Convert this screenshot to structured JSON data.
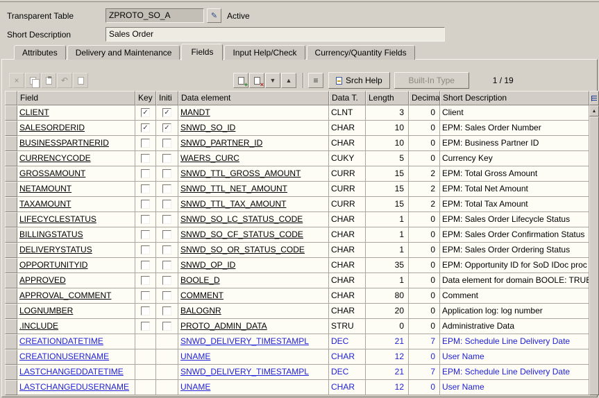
{
  "header": {
    "object_type_label": "Transparent Table",
    "object_name": "ZPROTO_SO_A",
    "status_label": "Active",
    "short_description_label": "Short Description",
    "short_description_value": "Sales Order"
  },
  "tabs": [
    {
      "label": "Attributes",
      "active": false
    },
    {
      "label": "Delivery and Maintenance",
      "active": false
    },
    {
      "label": "Fields",
      "active": true
    },
    {
      "label": "Input Help/Check",
      "active": false
    },
    {
      "label": "Currency/Quantity Fields",
      "active": false
    }
  ],
  "toolbar": {
    "srch_help_label": "Srch Help",
    "built_in_type_label": "Built-In Type",
    "position_indicator": "1  /  19"
  },
  "icons": {
    "check": "✓",
    "cut": "×",
    "undo": "↶",
    "plus": "+",
    "cross": "×",
    "filter": "▼",
    "expand": "▲",
    "display_change": "✎",
    "hierarchy": "≡",
    "scroll_up": "▲"
  },
  "table": {
    "columns": [
      "Field",
      "Key",
      "Initi",
      "Data element",
      "Data T.",
      "Length",
      "Decima",
      "Short Description"
    ],
    "rows": [
      {
        "field": "CLIENT",
        "key": true,
        "initial": true,
        "checkboxes": true,
        "data_element": "MANDT",
        "data_type": "CLNT",
        "length": "3",
        "decimals": "0",
        "description": "Client",
        "inherited": false
      },
      {
        "field": "SALESORDERID",
        "key": true,
        "initial": true,
        "checkboxes": true,
        "data_element": "SNWD_SO_ID",
        "data_type": "CHAR",
        "length": "10",
        "decimals": "0",
        "description": "EPM: Sales Order Number",
        "inherited": false
      },
      {
        "field": "BUSINESSPARTNERID",
        "key": false,
        "initial": false,
        "checkboxes": true,
        "data_element": "SNWD_PARTNER_ID",
        "data_type": "CHAR",
        "length": "10",
        "decimals": "0",
        "description": "EPM: Business Partner ID",
        "inherited": false
      },
      {
        "field": "CURRENCYCODE",
        "key": false,
        "initial": false,
        "checkboxes": true,
        "data_element": "WAERS_CURC",
        "data_type": "CUKY",
        "length": "5",
        "decimals": "0",
        "description": "Currency Key",
        "inherited": false
      },
      {
        "field": "GROSSAMOUNT",
        "key": false,
        "initial": false,
        "checkboxes": true,
        "data_element": "SNWD_TTL_GROSS_AMOUNT",
        "data_type": "CURR",
        "length": "15",
        "decimals": "2",
        "description": "EPM: Total Gross Amount",
        "inherited": false
      },
      {
        "field": "NETAMOUNT",
        "key": false,
        "initial": false,
        "checkboxes": true,
        "data_element": "SNWD_TTL_NET_AMOUNT",
        "data_type": "CURR",
        "length": "15",
        "decimals": "2",
        "description": "EPM: Total Net Amount",
        "inherited": false
      },
      {
        "field": "TAXAMOUNT",
        "key": false,
        "initial": false,
        "checkboxes": true,
        "data_element": "SNWD_TTL_TAX_AMOUNT",
        "data_type": "CURR",
        "length": "15",
        "decimals": "2",
        "description": "EPM: Total Tax Amount",
        "inherited": false
      },
      {
        "field": "LIFECYCLESTATUS",
        "key": false,
        "initial": false,
        "checkboxes": true,
        "data_element": "SNWD_SO_LC_STATUS_CODE",
        "data_type": "CHAR",
        "length": "1",
        "decimals": "0",
        "description": "EPM: Sales Order Lifecycle Status",
        "inherited": false
      },
      {
        "field": "BILLINGSTATUS",
        "key": false,
        "initial": false,
        "checkboxes": true,
        "data_element": "SNWD_SO_CF_STATUS_CODE",
        "data_type": "CHAR",
        "length": "1",
        "decimals": "0",
        "description": "EPM: Sales Order Confirmation Status",
        "inherited": false
      },
      {
        "field": "DELIVERYSTATUS",
        "key": false,
        "initial": false,
        "checkboxes": true,
        "data_element": "SNWD_SO_OR_STATUS_CODE",
        "data_type": "CHAR",
        "length": "1",
        "decimals": "0",
        "description": "EPM: Sales Order Ordering Status",
        "inherited": false
      },
      {
        "field": "OPPORTUNITYID",
        "key": false,
        "initial": false,
        "checkboxes": true,
        "data_element": "SNWD_OP_ID",
        "data_type": "CHAR",
        "length": "35",
        "decimals": "0",
        "description": "EPM: Opportunity ID for SoD IDoc proc",
        "inherited": false
      },
      {
        "field": "APPROVED",
        "key": false,
        "initial": false,
        "checkboxes": true,
        "data_element": "BOOLE_D",
        "data_type": "CHAR",
        "length": "1",
        "decimals": "0",
        "description": "Data element for domain BOOLE: TRUE",
        "inherited": false
      },
      {
        "field": "APPROVAL_COMMENT",
        "key": false,
        "initial": false,
        "checkboxes": true,
        "data_element": "COMMENT",
        "data_type": "CHAR",
        "length": "80",
        "decimals": "0",
        "description": "Comment",
        "inherited": false
      },
      {
        "field": "LOGNUMBER",
        "key": false,
        "initial": false,
        "checkboxes": true,
        "data_element": "BALOGNR",
        "data_type": "CHAR",
        "length": "20",
        "decimals": "0",
        "description": "Application log: log number",
        "inherited": false
      },
      {
        "field": ".INCLUDE",
        "key": false,
        "initial": false,
        "checkboxes": true,
        "data_element": "PROTO_ADMIN_DATA",
        "data_type": "STRU",
        "length": "0",
        "decimals": "0",
        "description": "Administrative Data",
        "inherited": false
      },
      {
        "field": "CREATIONDATETIME",
        "key": false,
        "initial": false,
        "checkboxes": false,
        "data_element": "SNWD_DELIVERY_TIMESTAMPL",
        "data_type": "DEC",
        "length": "21",
        "decimals": "7",
        "description": "EPM: Schedule Line Delivery Date",
        "inherited": true
      },
      {
        "field": "CREATIONUSERNAME",
        "key": false,
        "initial": false,
        "checkboxes": false,
        "data_element": "UNAME",
        "data_type": "CHAR",
        "length": "12",
        "decimals": "0",
        "description": "User Name",
        "inherited": true
      },
      {
        "field": "LASTCHANGEDDATETIME",
        "key": false,
        "initial": false,
        "checkboxes": false,
        "data_element": "SNWD_DELIVERY_TIMESTAMPL",
        "data_type": "DEC",
        "length": "21",
        "decimals": "7",
        "description": "EPM: Schedule Line Delivery Date",
        "inherited": true
      },
      {
        "field": "LASTCHANGEDUSERNAME",
        "key": false,
        "initial": false,
        "checkboxes": false,
        "data_element": "UNAME",
        "data_type": "CHAR",
        "length": "12",
        "decimals": "0",
        "description": "User Name",
        "inherited": true
      }
    ]
  }
}
